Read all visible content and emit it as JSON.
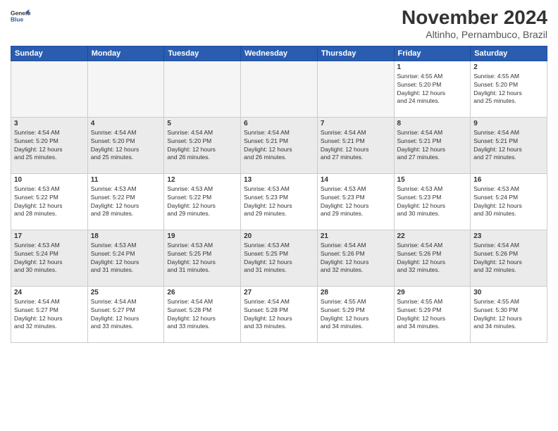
{
  "header": {
    "logo_line1": "General",
    "logo_line2": "Blue",
    "month_year": "November 2024",
    "location": "Altinho, Pernambuco, Brazil"
  },
  "weekdays": [
    "Sunday",
    "Monday",
    "Tuesday",
    "Wednesday",
    "Thursday",
    "Friday",
    "Saturday"
  ],
  "weeks": [
    [
      {
        "day": "",
        "info": ""
      },
      {
        "day": "",
        "info": ""
      },
      {
        "day": "",
        "info": ""
      },
      {
        "day": "",
        "info": ""
      },
      {
        "day": "",
        "info": ""
      },
      {
        "day": "1",
        "info": "Sunrise: 4:55 AM\nSunset: 5:20 PM\nDaylight: 12 hours\nand 24 minutes."
      },
      {
        "day": "2",
        "info": "Sunrise: 4:55 AM\nSunset: 5:20 PM\nDaylight: 12 hours\nand 25 minutes."
      }
    ],
    [
      {
        "day": "3",
        "info": "Sunrise: 4:54 AM\nSunset: 5:20 PM\nDaylight: 12 hours\nand 25 minutes."
      },
      {
        "day": "4",
        "info": "Sunrise: 4:54 AM\nSunset: 5:20 PM\nDaylight: 12 hours\nand 25 minutes."
      },
      {
        "day": "5",
        "info": "Sunrise: 4:54 AM\nSunset: 5:20 PM\nDaylight: 12 hours\nand 26 minutes."
      },
      {
        "day": "6",
        "info": "Sunrise: 4:54 AM\nSunset: 5:21 PM\nDaylight: 12 hours\nand 26 minutes."
      },
      {
        "day": "7",
        "info": "Sunrise: 4:54 AM\nSunset: 5:21 PM\nDaylight: 12 hours\nand 27 minutes."
      },
      {
        "day": "8",
        "info": "Sunrise: 4:54 AM\nSunset: 5:21 PM\nDaylight: 12 hours\nand 27 minutes."
      },
      {
        "day": "9",
        "info": "Sunrise: 4:54 AM\nSunset: 5:21 PM\nDaylight: 12 hours\nand 27 minutes."
      }
    ],
    [
      {
        "day": "10",
        "info": "Sunrise: 4:53 AM\nSunset: 5:22 PM\nDaylight: 12 hours\nand 28 minutes."
      },
      {
        "day": "11",
        "info": "Sunrise: 4:53 AM\nSunset: 5:22 PM\nDaylight: 12 hours\nand 28 minutes."
      },
      {
        "day": "12",
        "info": "Sunrise: 4:53 AM\nSunset: 5:22 PM\nDaylight: 12 hours\nand 29 minutes."
      },
      {
        "day": "13",
        "info": "Sunrise: 4:53 AM\nSunset: 5:23 PM\nDaylight: 12 hours\nand 29 minutes."
      },
      {
        "day": "14",
        "info": "Sunrise: 4:53 AM\nSunset: 5:23 PM\nDaylight: 12 hours\nand 29 minutes."
      },
      {
        "day": "15",
        "info": "Sunrise: 4:53 AM\nSunset: 5:23 PM\nDaylight: 12 hours\nand 30 minutes."
      },
      {
        "day": "16",
        "info": "Sunrise: 4:53 AM\nSunset: 5:24 PM\nDaylight: 12 hours\nand 30 minutes."
      }
    ],
    [
      {
        "day": "17",
        "info": "Sunrise: 4:53 AM\nSunset: 5:24 PM\nDaylight: 12 hours\nand 30 minutes."
      },
      {
        "day": "18",
        "info": "Sunrise: 4:53 AM\nSunset: 5:24 PM\nDaylight: 12 hours\nand 31 minutes."
      },
      {
        "day": "19",
        "info": "Sunrise: 4:53 AM\nSunset: 5:25 PM\nDaylight: 12 hours\nand 31 minutes."
      },
      {
        "day": "20",
        "info": "Sunrise: 4:53 AM\nSunset: 5:25 PM\nDaylight: 12 hours\nand 31 minutes."
      },
      {
        "day": "21",
        "info": "Sunrise: 4:54 AM\nSunset: 5:26 PM\nDaylight: 12 hours\nand 32 minutes."
      },
      {
        "day": "22",
        "info": "Sunrise: 4:54 AM\nSunset: 5:26 PM\nDaylight: 12 hours\nand 32 minutes."
      },
      {
        "day": "23",
        "info": "Sunrise: 4:54 AM\nSunset: 5:26 PM\nDaylight: 12 hours\nand 32 minutes."
      }
    ],
    [
      {
        "day": "24",
        "info": "Sunrise: 4:54 AM\nSunset: 5:27 PM\nDaylight: 12 hours\nand 32 minutes."
      },
      {
        "day": "25",
        "info": "Sunrise: 4:54 AM\nSunset: 5:27 PM\nDaylight: 12 hours\nand 33 minutes."
      },
      {
        "day": "26",
        "info": "Sunrise: 4:54 AM\nSunset: 5:28 PM\nDaylight: 12 hours\nand 33 minutes."
      },
      {
        "day": "27",
        "info": "Sunrise: 4:54 AM\nSunset: 5:28 PM\nDaylight: 12 hours\nand 33 minutes."
      },
      {
        "day": "28",
        "info": "Sunrise: 4:55 AM\nSunset: 5:29 PM\nDaylight: 12 hours\nand 34 minutes."
      },
      {
        "day": "29",
        "info": "Sunrise: 4:55 AM\nSunset: 5:29 PM\nDaylight: 12 hours\nand 34 minutes."
      },
      {
        "day": "30",
        "info": "Sunrise: 4:55 AM\nSunset: 5:30 PM\nDaylight: 12 hours\nand 34 minutes."
      }
    ]
  ],
  "shaded_rows": [
    1,
    3
  ],
  "colors": {
    "header_bg": "#2a5db0",
    "header_text": "#ffffff",
    "shaded_row": "#ebebeb",
    "border": "#cccccc"
  }
}
